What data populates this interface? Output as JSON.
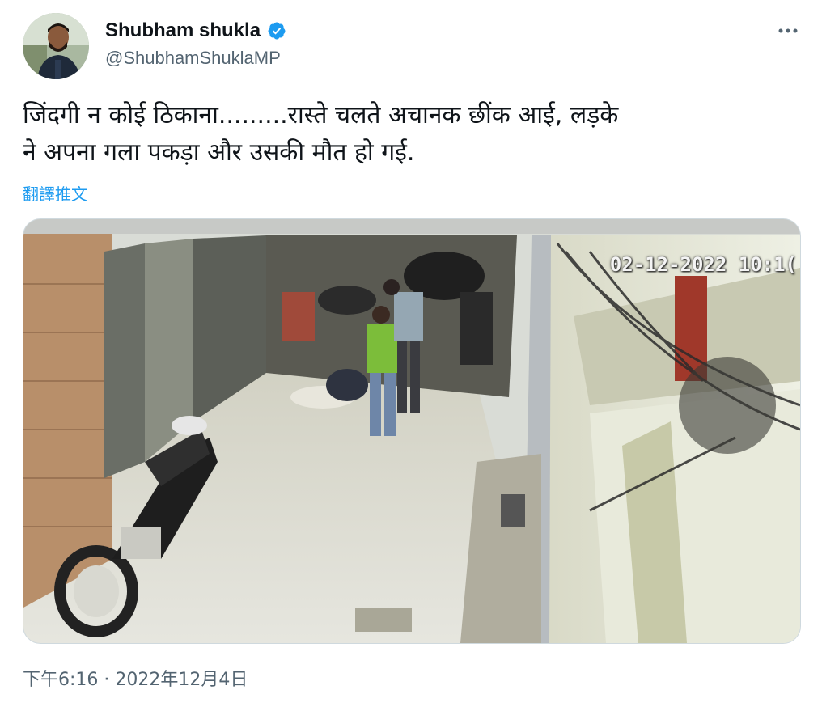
{
  "author": {
    "display_name": "Shubham shukla",
    "handle": "@ShubhamShuklaMP",
    "verified": true,
    "verified_color": "#1d9bf0",
    "avatar_icon": "profile-photo-man-beard"
  },
  "menu": {
    "more_icon": "ellipsis-icon"
  },
  "tweet": {
    "text": "जिंदगी न कोई ठिकाना.........रास्ते चलते अचानक छींक आई, लड़के\nने अपना गला पकड़ा और उसकी मौत हो गई.",
    "translate_label": "翻譯推文"
  },
  "media": {
    "type": "cctv-video",
    "overlay_timestamp": "02-12-2022 10:1("
  },
  "footer": {
    "timestamp": "下午6:16 · 2022年12月4日"
  },
  "colors": {
    "link": "#1d9bf0",
    "secondary_text": "#536471",
    "primary_text": "#0f1419"
  }
}
